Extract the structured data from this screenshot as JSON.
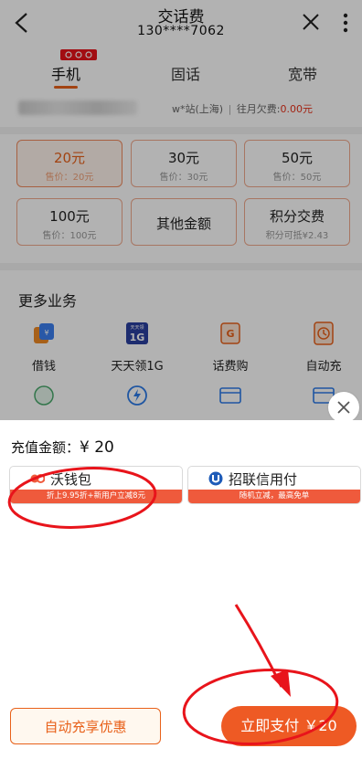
{
  "header": {
    "title": "交话费",
    "subtitle": "130****7062"
  },
  "tabs": [
    {
      "label": "手机",
      "active": true
    },
    {
      "label": "固话",
      "active": false
    },
    {
      "label": "宽带",
      "active": false
    }
  ],
  "account": {
    "name": "w*站(上海)",
    "separator": "|",
    "arrears_label": "往月欠费:",
    "arrears_amount": "0.00元"
  },
  "amounts": [
    {
      "value": "20元",
      "price": "售价：20元",
      "selected": true
    },
    {
      "value": "30元",
      "price": "售价：30元",
      "selected": false
    },
    {
      "value": "50元",
      "price": "售价：50元",
      "selected": false
    },
    {
      "value": "100元",
      "price": "售价：100元",
      "selected": false
    },
    {
      "value": "其他金额",
      "price": "",
      "selected": false
    },
    {
      "value": "积分交费",
      "price": "积分可抵¥2.43",
      "selected": false
    }
  ],
  "more_services": {
    "title": "更多业务",
    "items": [
      {
        "label": "借钱",
        "icon": "loan-icon"
      },
      {
        "label": "天天领1G",
        "icon": "daily-1g-icon",
        "icon_text": "1G",
        "icon_caption": "天天领"
      },
      {
        "label": "话费购",
        "icon": "bill-shop-icon",
        "icon_text": "G"
      },
      {
        "label": "自动充",
        "icon": "auto-recharge-icon"
      }
    ]
  },
  "sheet": {
    "charge_label": "充值金额：",
    "charge_amount": "¥ 20",
    "pay_methods": [
      {
        "name": "沃钱包",
        "promo": "折上9.95折+新用户立减8元",
        "icon": "wo-wallet-icon"
      },
      {
        "name": "招联信用付",
        "promo": "随机立减，最高免单",
        "icon": "zhaolian-icon"
      }
    ],
    "auto_button": "自动充享优惠",
    "pay_button": "立即支付 ￥20"
  },
  "colors": {
    "accent": "#e8611a",
    "pay_button": "#ee5a24",
    "promo_bar": "#ef5a3c",
    "annotation": "#e8141b"
  }
}
